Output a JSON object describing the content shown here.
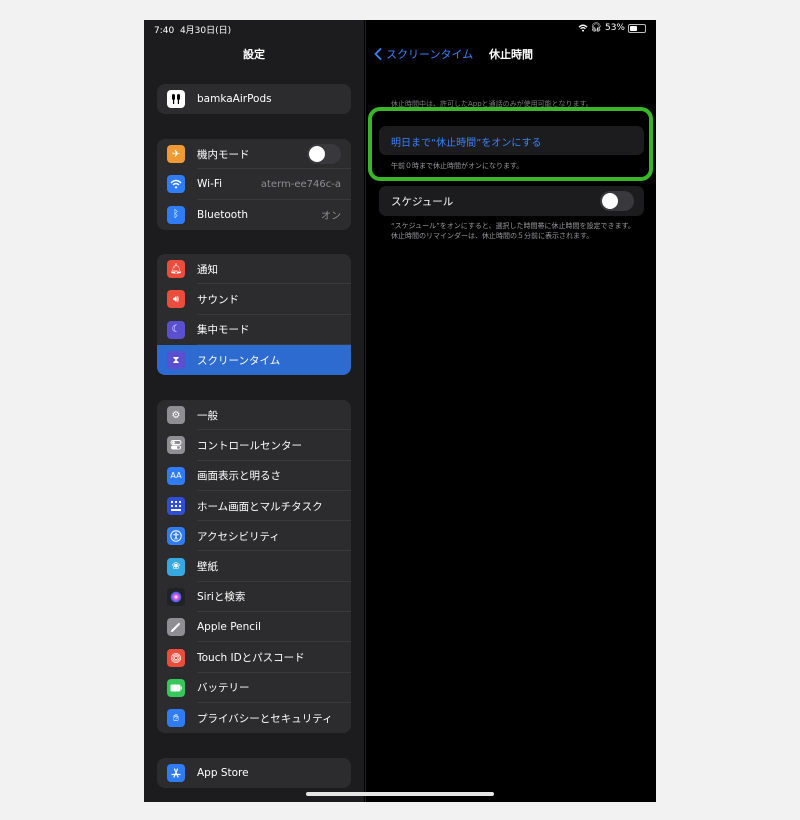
{
  "status": {
    "time": "7:40",
    "date": "4月30日(日)",
    "battery": "53%",
    "battery_level": 0.53
  },
  "sidebar": {
    "title": "設定",
    "account": {
      "label": "bamkaAirPods"
    },
    "connectivity": [
      {
        "label": "機内モード",
        "icon": "airplane-icon",
        "color": "#f09a36",
        "value": "",
        "toggle": true
      },
      {
        "label": "Wi-Fi",
        "icon": "wifi-icon",
        "color": "#2f7cf6",
        "value": "aterm-ee746c-a",
        "toggle": false
      },
      {
        "label": "Bluetooth",
        "icon": "bluetooth-icon",
        "color": "#2f7cf6",
        "value": "オン",
        "toggle": false
      }
    ],
    "notifications": [
      {
        "label": "通知",
        "icon": "bell-icon",
        "color": "#eb4d3d"
      },
      {
        "label": "サウンド",
        "icon": "speaker-icon",
        "color": "#eb4d3d"
      },
      {
        "label": "集中モード",
        "icon": "moon-icon",
        "color": "#5a4fcf"
      },
      {
        "label": "スクリーンタイム",
        "icon": "hourglass-icon",
        "color": "#5a4fcf"
      }
    ],
    "general": [
      {
        "label": "一般",
        "icon": "gear-icon",
        "color": "#8e8e93"
      },
      {
        "label": "コントロールセンター",
        "icon": "switches-icon",
        "color": "#8e8e93"
      },
      {
        "label": "画面表示と明るさ",
        "icon": "text-size-icon",
        "color": "#2f7cf6"
      },
      {
        "label": "ホーム画面とマルチタスク",
        "icon": "grid-icon",
        "color": "#2f50d6"
      },
      {
        "label": "アクセシビリティ",
        "icon": "accessibility-icon",
        "color": "#2f7cf6"
      },
      {
        "label": "壁紙",
        "icon": "flower-icon",
        "color": "#37a8e0"
      },
      {
        "label": "Siriと検索",
        "icon": "siri-icon",
        "color": "#222222"
      },
      {
        "label": "Apple Pencil",
        "icon": "pencil-icon",
        "color": "#8e8e93"
      },
      {
        "label": "Touch IDとパスコード",
        "icon": "fingerprint-icon",
        "color": "#eb4d3d"
      },
      {
        "label": "バッテリー",
        "icon": "battery-icon",
        "color": "#34c759"
      },
      {
        "label": "プライバシーとセキュリティ",
        "icon": "hand-icon",
        "color": "#2f7cf6"
      }
    ],
    "store": [
      {
        "label": "App Store",
        "icon": "appstore-icon",
        "color": "#2f7cf6"
      }
    ]
  },
  "detail": {
    "back_label": "スクリーンタイム",
    "title": "休止時間",
    "description": "休止時間中は、許可したAppと通話のみが使用可能となります。",
    "action_label": "明日まで“休止時間”をオンにする",
    "action_note": "午前０時まで休止時間がオンになります。",
    "schedule_label": "スケジュール",
    "schedule_note": "“スケジュール”をオンにすると、選択した時間帯に休止時間を設定できます。休止時間のリマインダーは、休止時間の５分前に表示されます。"
  },
  "colors": {
    "accent": "#3a82f7",
    "highlight_border": "#3bb52a",
    "selected": "#2e6bd1"
  }
}
